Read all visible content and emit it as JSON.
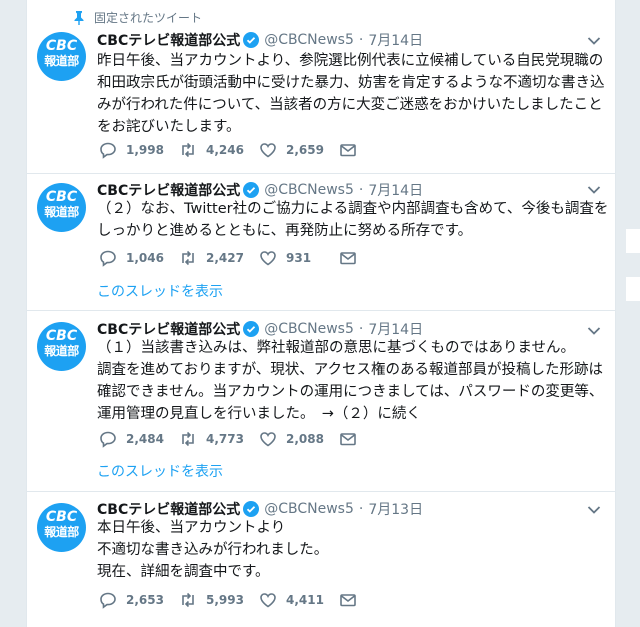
{
  "pinned_label": "固定されたツイート",
  "colors": {
    "accent": "#1da1f2",
    "text": "#14171a",
    "muted": "#657786"
  },
  "tweets": [
    {
      "avatar": {
        "top": "CBC",
        "bottom": "報道部"
      },
      "name": "CBCテレビ報道部公式",
      "handle": "@CBCNews5",
      "separator": "·",
      "date": "7月14日",
      "text": "昨日午後、当アカウントより、参院選比例代表に立候補している自民党現職の和田政宗氏が街頭活動中に受けた暴力、妨害を肯定するような不適切な書き込みが行われた件について、当該者の方に大変ご迷惑をおかけいたしましたことをお詫びいたします。",
      "replies": "1,998",
      "retweets": "4,246",
      "likes": "2,659"
    },
    {
      "avatar": {
        "top": "CBC",
        "bottom": "報道部"
      },
      "name": "CBCテレビ報道部公式",
      "handle": "@CBCNews5",
      "separator": "·",
      "date": "7月14日",
      "text": "（２）なお、Twitter社のご協力による調査や内部調査も含めて、今後も調査をしっかりと進めるとともに、再発防止に努める所存です。",
      "replies": "1,046",
      "retweets": "2,427",
      "likes": "931",
      "thread_link": "このスレッドを表示"
    },
    {
      "avatar": {
        "top": "CBC",
        "bottom": "報道部"
      },
      "name": "CBCテレビ報道部公式",
      "handle": "@CBCNews5",
      "separator": "·",
      "date": "7月14日",
      "text": "（１）当該書き込みは、弊社報道部の意思に基づくものではありません。\n調査を進めておりますが、現状、アクセス権のある報道部員が投稿した形跡は確認できません。当アカウントの運用につきましては、パスワードの変更等、運用管理の見直しを行いました。　→（２）に続く",
      "replies": "2,484",
      "retweets": "4,773",
      "likes": "2,088",
      "thread_link": "このスレッドを表示"
    },
    {
      "avatar": {
        "top": "CBC",
        "bottom": "報道部"
      },
      "name": "CBCテレビ報道部公式",
      "handle": "@CBCNews5",
      "separator": "·",
      "date": "7月13日",
      "text": "本日午後、当アカウントより\n不適切な書き込みが行われました。\n現在、詳細を調査中です。",
      "replies": "2,653",
      "retweets": "5,993",
      "likes": "4,411"
    }
  ]
}
